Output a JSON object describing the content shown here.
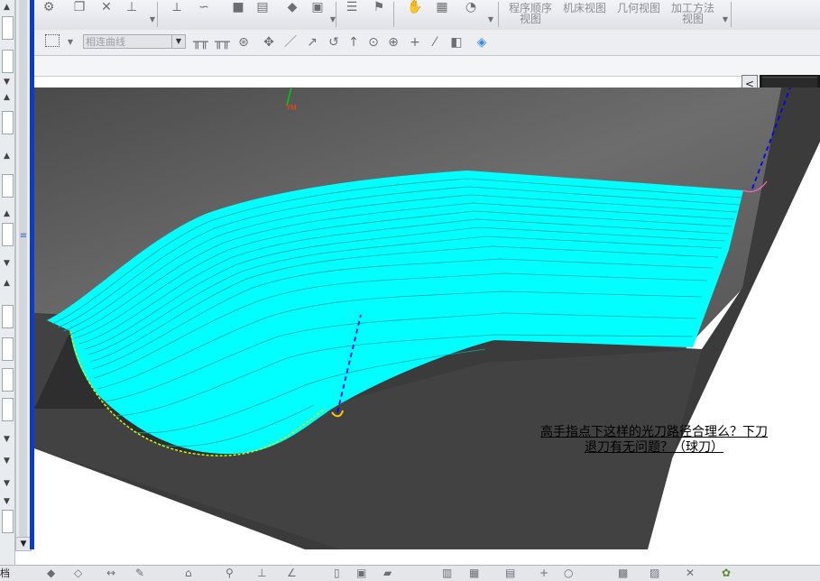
{
  "toolbar_views": {
    "program_order": "程序顺序\n视图",
    "machine_tool": "机床视图",
    "geometry": "几何视图",
    "machining_method": "加工方法\n视图"
  },
  "curve_filter": {
    "value": "相连曲线"
  },
  "viewport": {
    "wcs_label": "YM",
    "caption_line1": "高手指点下这样的光刀路径合理么？下刀",
    "caption_line2": "退刀有无问题？（球刀）"
  },
  "status": {
    "left_text": "档"
  },
  "colors": {
    "toolpath": "#00ffff",
    "model_dark": "#3b3b3b",
    "background_gray": "#6a6a6a",
    "accent_blue": "#0a3cc8",
    "engage_line": "#0000ff"
  },
  "icons": {
    "toolbar1": [
      "operation-icon",
      "copy-icon",
      "delete-icon",
      "paste-icon",
      "tool-icon",
      "path-icon",
      "block-icon",
      "check-icon",
      "edit-icon",
      "display-icon",
      "sort-icon",
      "param-icon",
      "output-icon",
      "post-icon",
      "clock-icon"
    ],
    "toolbar2": [
      "select-box-icon",
      "snap-endpoint-icon",
      "snap-midpoint-icon",
      "snap-reset-icon",
      "move-icon",
      "line-icon",
      "arrow-icon",
      "curve-icon",
      "point-icon",
      "circle-icon",
      "center-icon",
      "plus-icon",
      "slash-icon",
      "cube-shade-icon",
      "cube-icon"
    ]
  }
}
